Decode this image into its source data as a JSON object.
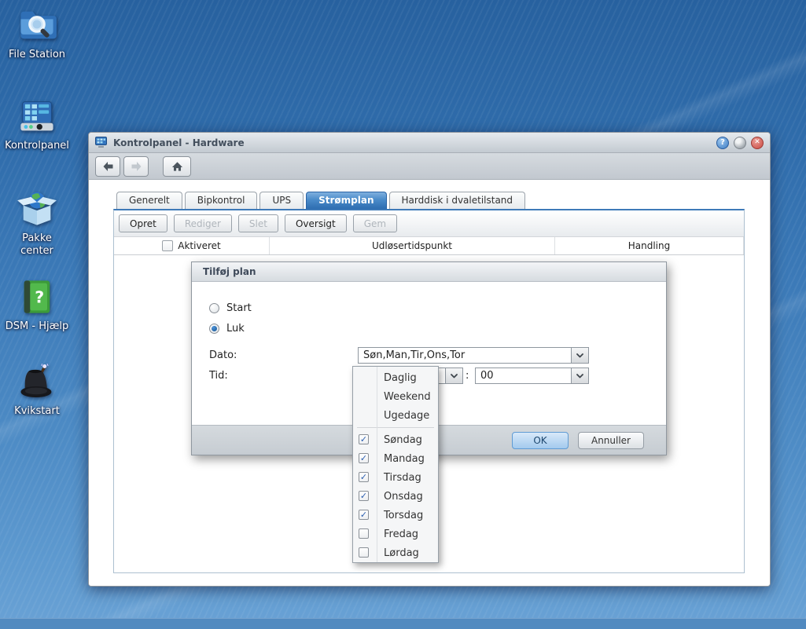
{
  "desktop": {
    "icons": [
      {
        "name": "file-station",
        "label": "File Station"
      },
      {
        "name": "control-panel",
        "label": "Kontrolpanel"
      },
      {
        "name": "package-center",
        "label": "Pakke center"
      },
      {
        "name": "dsm-help",
        "label": "DSM - Hjælp"
      },
      {
        "name": "quick-start",
        "label": "Kvikstart"
      }
    ]
  },
  "window": {
    "title": "Kontrolpanel - Hardware",
    "titlebar": {
      "help_glyph": "?",
      "close_glyph": "✕"
    },
    "tabs": [
      {
        "label": "Generelt",
        "active": false
      },
      {
        "label": "Bipkontrol",
        "active": false
      },
      {
        "label": "UPS",
        "active": false
      },
      {
        "label": "Strømplan",
        "active": true
      },
      {
        "label": "Harddisk i dvaletilstand",
        "active": false
      }
    ],
    "toolbar": [
      {
        "label": "Opret",
        "enabled": true
      },
      {
        "label": "Rediger",
        "enabled": false
      },
      {
        "label": "Slet",
        "enabled": false
      },
      {
        "label": "Oversigt",
        "enabled": true
      },
      {
        "label": "Gem",
        "enabled": false
      }
    ],
    "table_columns": [
      {
        "label": "Aktiveret",
        "has_checkbox": true
      },
      {
        "label": "Udløsertidspunkt",
        "has_checkbox": false
      },
      {
        "label": "Handling",
        "has_checkbox": false
      }
    ]
  },
  "dialog": {
    "title": "Tilføj plan",
    "radios": [
      {
        "label": "Start",
        "selected": false
      },
      {
        "label": "Luk",
        "selected": true
      }
    ],
    "fields": {
      "date_label": "Dato:",
      "date_value": "Søn,Man,Tir,Ons,Tor",
      "time_label": "Tid:",
      "time_separator": ":",
      "minute_value": "00"
    },
    "buttons": {
      "ok": "OK",
      "cancel": "Annuller"
    }
  },
  "dropdown_panel": {
    "presets": [
      "Daglig",
      "Weekend",
      "Ugedage"
    ],
    "days": [
      {
        "label": "Søndag",
        "checked": true
      },
      {
        "label": "Mandag",
        "checked": true
      },
      {
        "label": "Tirsdag",
        "checked": true
      },
      {
        "label": "Onsdag",
        "checked": true
      },
      {
        "label": "Torsdag",
        "checked": true
      },
      {
        "label": "Fredag",
        "checked": false
      },
      {
        "label": "Lørdag",
        "checked": false
      }
    ],
    "check_glyph": "✓"
  },
  "colors": {
    "desktop_top": "#27619f",
    "desktop_bottom": "#6aa2d5",
    "active_tab_blue": "#2e6db1",
    "panel_border_blue": "#3e7ab8",
    "ok_button_border": "#5f9bd4",
    "close_red": "#c94a42",
    "help_blue": "#3c7cc4",
    "check_blue": "#2b5fb0"
  }
}
